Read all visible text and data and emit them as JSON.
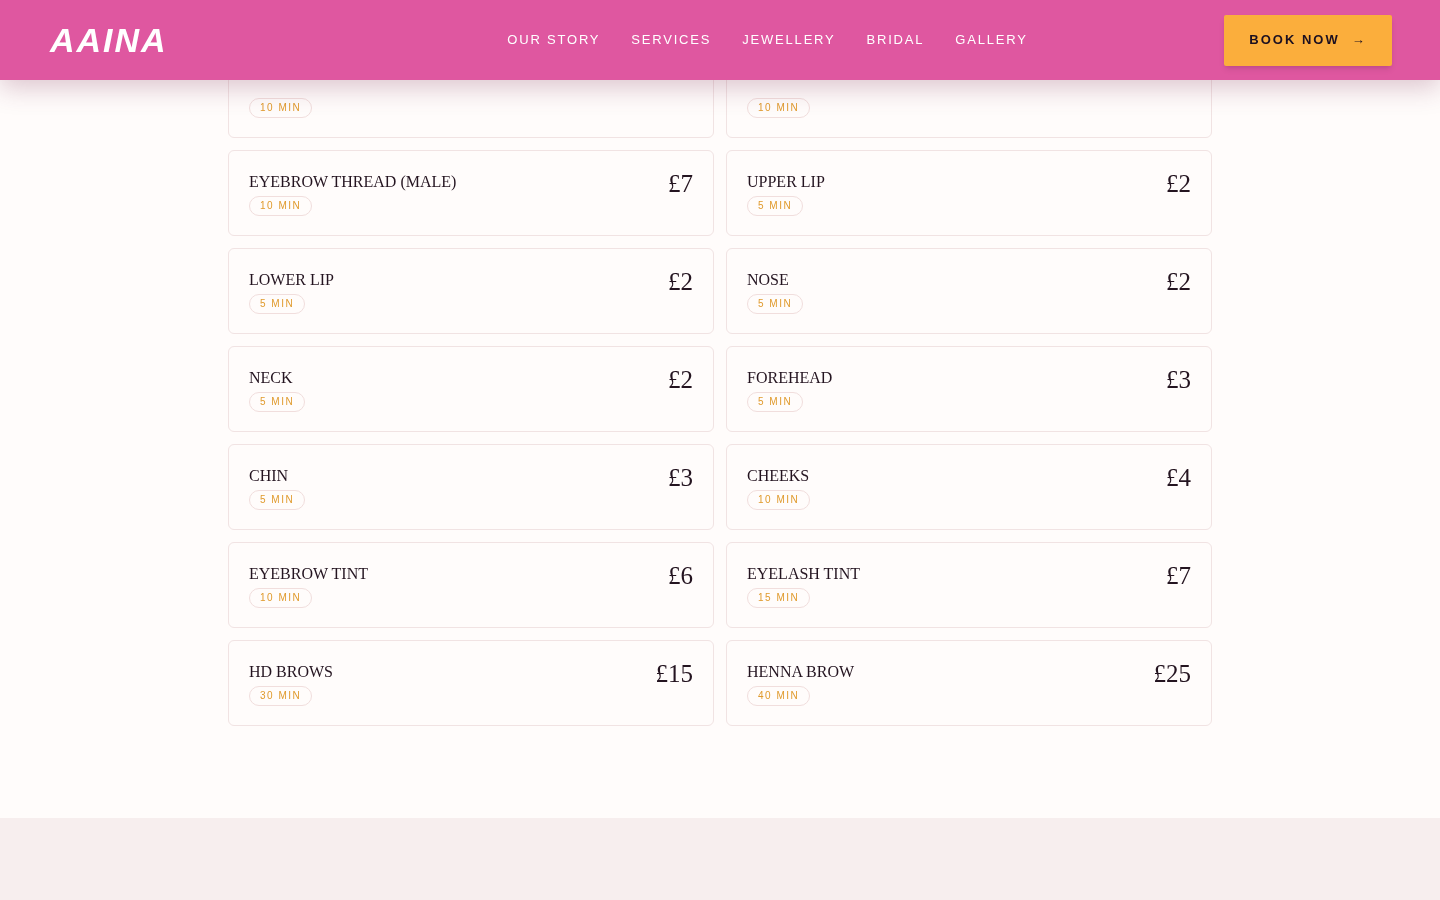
{
  "header": {
    "logo": "AAINA",
    "nav": [
      "OUR STORY",
      "SERVICES",
      "JEWELLERY",
      "BRIDAL",
      "GALLERY"
    ],
    "cta": {
      "label": "BOOK NOW",
      "arrow": "→"
    }
  },
  "services": [
    {
      "duration": "10 MIN"
    },
    {
      "duration": "10 MIN"
    },
    {
      "name": "EYEBROW THREAD (MALE)",
      "price": "£7",
      "duration": "10 MIN"
    },
    {
      "name": "UPPER LIP",
      "price": "£2",
      "duration": "5 MIN"
    },
    {
      "name": "LOWER LIP",
      "price": "£2",
      "duration": "5 MIN"
    },
    {
      "name": "NOSE",
      "price": "£2",
      "duration": "5 MIN"
    },
    {
      "name": "NECK",
      "price": "£2",
      "duration": "5 MIN"
    },
    {
      "name": "FOREHEAD",
      "price": "£3",
      "duration": "5 MIN"
    },
    {
      "name": "CHIN",
      "price": "£3",
      "duration": "5 MIN"
    },
    {
      "name": "CHEEKS",
      "price": "£4",
      "duration": "10 MIN"
    },
    {
      "name": "EYEBROW TINT",
      "price": "£6",
      "duration": "10 MIN"
    },
    {
      "name": "EYELASH TINT",
      "price": "£7",
      "duration": "15 MIN"
    },
    {
      "name": "HD BROWS",
      "price": "£15",
      "duration": "30 MIN"
    },
    {
      "name": "HENNA BROW",
      "price": "£25",
      "duration": "40 MIN"
    }
  ]
}
